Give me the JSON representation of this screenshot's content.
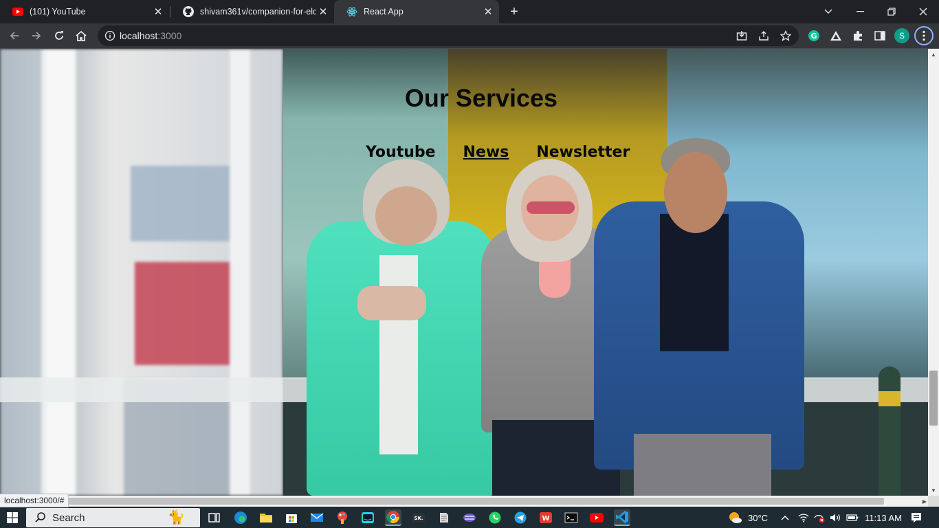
{
  "browser": {
    "tabs": [
      {
        "title": "(101) YouTube",
        "icon": "youtube-icon",
        "active": false
      },
      {
        "title": "shivam361v/companion-for-elde",
        "icon": "github-icon",
        "active": false
      },
      {
        "title": "React App",
        "icon": "react-icon",
        "active": true
      }
    ],
    "tab_close_glyph": "✕",
    "new_tab_glyph": "+",
    "address": {
      "host": "localhost",
      "port": ":3000"
    },
    "profile_initial": "S",
    "status_link": "localhost:3000/#"
  },
  "page": {
    "title": "Our Services",
    "nav": [
      {
        "label": "Youtube",
        "active": false
      },
      {
        "label": "News",
        "active": true
      },
      {
        "label": "Newsletter",
        "active": false
      }
    ]
  },
  "taskbar": {
    "search_label": "Search",
    "weather": "30°C",
    "time": "11:13 AM"
  },
  "colors": {
    "accent": "#8ab4f8",
    "profile_badge": "#0f9d8a",
    "grammarly": "#15c39a"
  }
}
